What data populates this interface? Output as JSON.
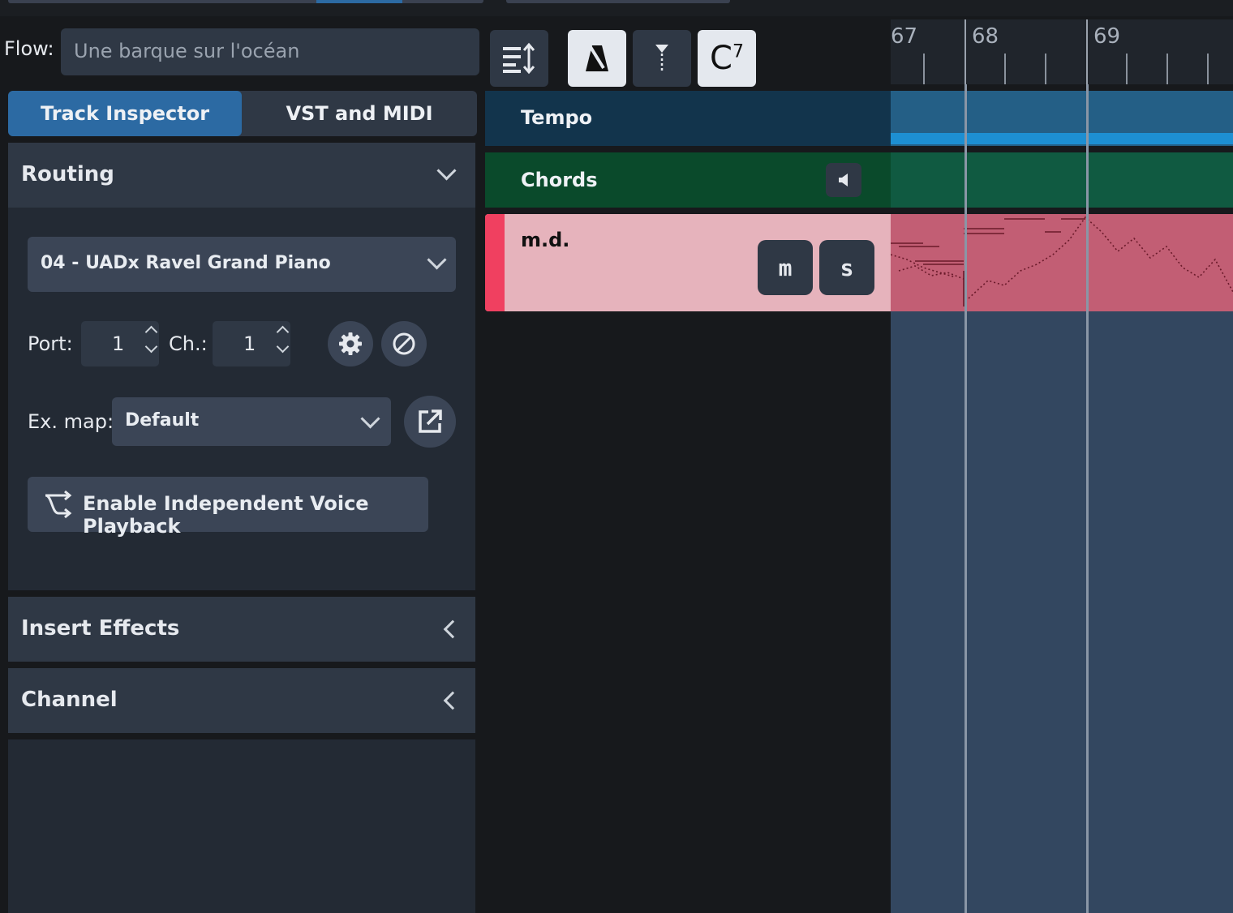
{
  "flow": {
    "label": "Flow:",
    "value": "Une barque sur l'océan"
  },
  "toolbar": {
    "buttons": [
      {
        "icon": "track-height-icon",
        "active": false
      },
      {
        "icon": "metronome-icon",
        "active": true
      },
      {
        "icon": "tempo-marker-icon",
        "active": false
      },
      {
        "icon": "chord-symbol-icon",
        "active": true,
        "label": "C",
        "superscript": "7"
      }
    ]
  },
  "tabs": [
    {
      "label": "Track Inspector",
      "active": true
    },
    {
      "label": "VST and MIDI",
      "active": false
    }
  ],
  "routing": {
    "title": "Routing",
    "device": "04 - UADx Ravel Grand Piano",
    "port_label": "Port:",
    "port_value": "1",
    "channel_label": "Ch.:",
    "channel_value": "1",
    "exmap_label": "Ex. map:",
    "exmap_value": "Default",
    "ivp_label": "Enable Independent Voice Playback"
  },
  "sections": {
    "insert_effects": "Insert Effects",
    "channel": "Channel"
  },
  "tracks": {
    "tempo": "Tempo",
    "chords": "Chords",
    "instrument": "m.d.",
    "mute_label": "m",
    "solo_label": "s"
  },
  "ruler": {
    "bars": [
      "67",
      "68",
      "69"
    ]
  },
  "colors": {
    "accent": "#2c6aa3",
    "tempo_track": "#12344c",
    "chords_track": "#0a4a2b",
    "instrument_track": "#e6b3bc",
    "instrument_stripe": "#f04060",
    "timeline_bg": "#334760"
  }
}
